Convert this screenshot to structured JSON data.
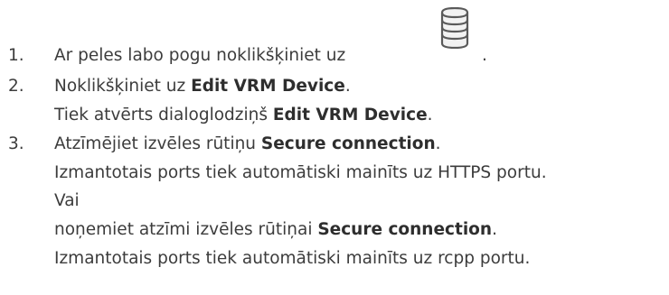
{
  "steps": [
    {
      "number": "1.",
      "text_before": "Ar peles labo pogu noklikšķiniet uz",
      "icon": "database-stack-icon",
      "text_after": "."
    },
    {
      "number": "2.",
      "text_before": "Noklikšķiniet uz ",
      "bold": "Edit VRM Device",
      "text_after": ".",
      "result_before": "Tiek atvērts dialoglodziņš ",
      "result_bold": "Edit VRM Device",
      "result_after": "."
    },
    {
      "number": "3.",
      "text_before": "Atzīmējiet izvēles rūtiņu ",
      "bold": "Secure connection",
      "text_after": ".",
      "result": "Izmantotais ports tiek automātiski mainīts uz HTTPS portu.",
      "or": "Vai",
      "alt_before": "noņemiet atzīmi izvēles rūtiņai ",
      "alt_bold": "Secure connection",
      "alt_after": ".",
      "alt_result": "Izmantotais ports tiek automātiski mainīts uz rcpp portu."
    }
  ]
}
